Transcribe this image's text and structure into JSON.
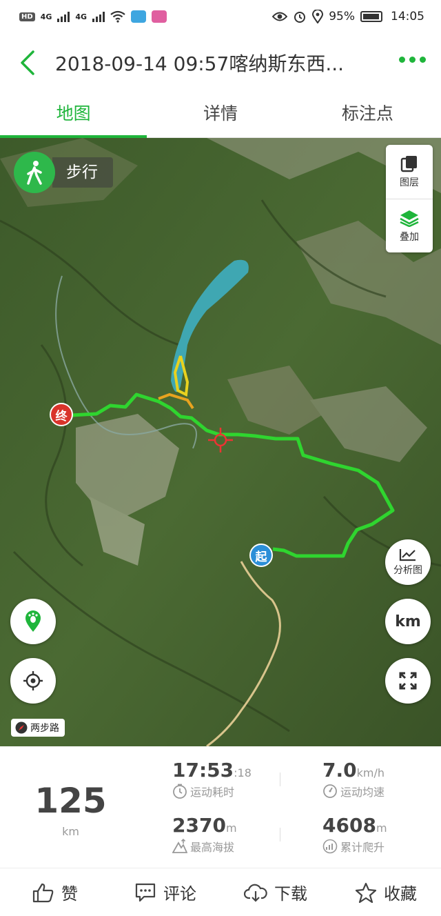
{
  "status_bar": {
    "hd": "HD",
    "net1": "4G",
    "net2": "4G",
    "battery": "95%",
    "time": "14:05"
  },
  "header": {
    "title": "2018-09-14 09:57喀纳斯东西..."
  },
  "tabs": [
    {
      "label": "地图",
      "active": true
    },
    {
      "label": "详情",
      "active": false
    },
    {
      "label": "标注点",
      "active": false
    }
  ],
  "map": {
    "mode_label": "步行",
    "layers_label": "图层",
    "overlay_label": "叠加",
    "analysis_label": "分析图",
    "unit_label": "km",
    "brand_label": "两步路",
    "start_marker": "起",
    "end_marker": "终",
    "track_color": "#2fd52f",
    "accent_color": "#1fb53b"
  },
  "stats": {
    "distance": {
      "value": "125",
      "unit": "km"
    },
    "duration": {
      "value": "17:53",
      "suffix": ":18",
      "label": "运动耗时"
    },
    "avg_speed": {
      "value": "7.0",
      "unit": "km/h",
      "label": "运动均速"
    },
    "max_altitude": {
      "value": "2370",
      "unit": "m",
      "label": "最高海拔"
    },
    "total_climb": {
      "value": "4608",
      "unit": "m",
      "label": "累计爬升"
    }
  },
  "actions": [
    {
      "label": "赞",
      "icon": "thumbs-up-icon"
    },
    {
      "label": "评论",
      "icon": "comment-icon"
    },
    {
      "label": "下载",
      "icon": "cloud-download-icon"
    },
    {
      "label": "收藏",
      "icon": "star-icon"
    }
  ]
}
